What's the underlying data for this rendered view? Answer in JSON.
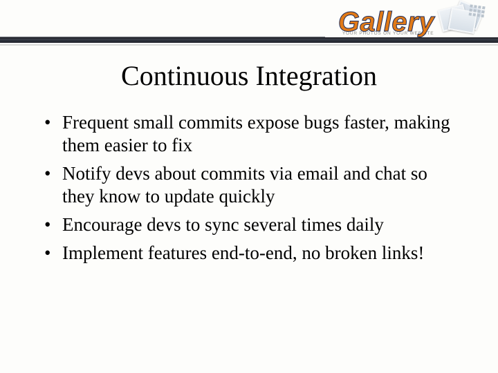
{
  "header": {
    "logo_text": "Gallery",
    "logo_tagline": "YOUR PHOTOS ON YOUR WEBSITE"
  },
  "title": "Continuous Integration",
  "bullets": [
    "Frequent small commits expose bugs faster, making them easier to fix",
    "Notify devs about commits via email and chat so they know to update quickly",
    "Encourage devs to sync several times daily",
    "Implement features end-to-end, no broken links!"
  ]
}
